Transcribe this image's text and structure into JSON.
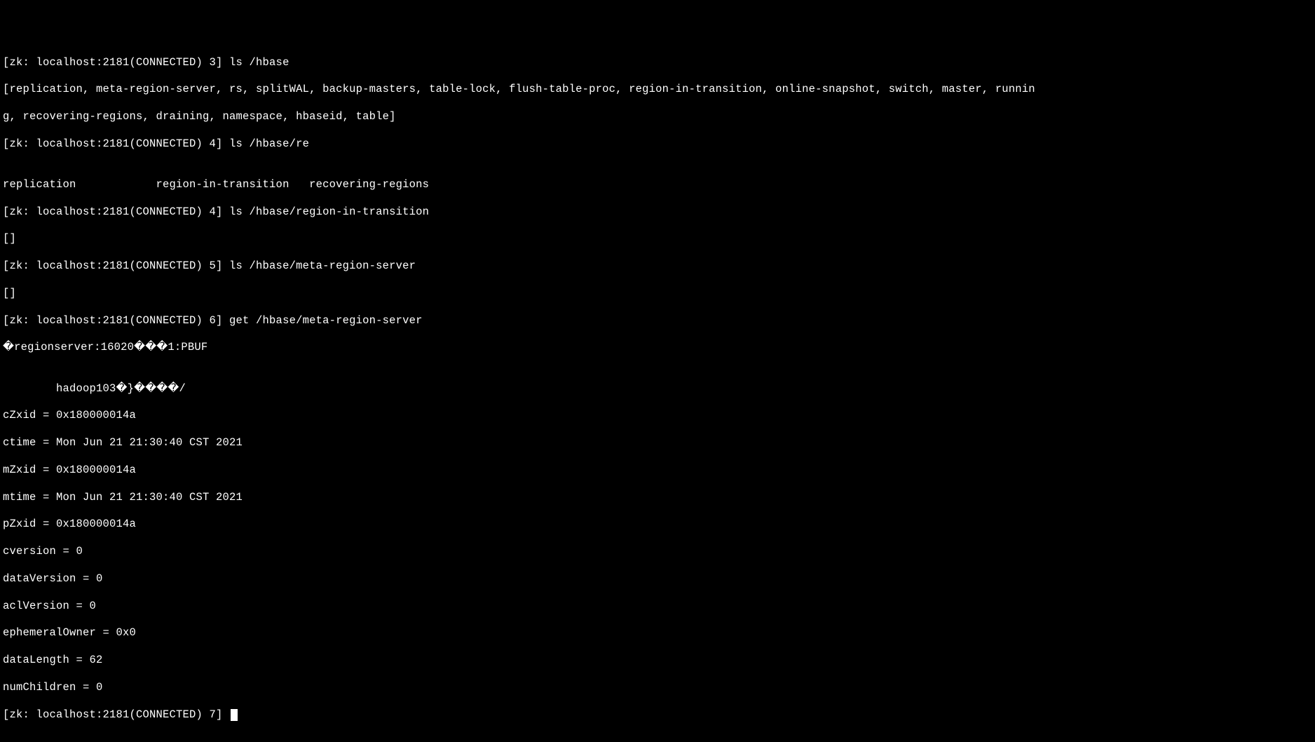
{
  "lines": {
    "l1": "[zk: localhost:2181(CONNECTED) 3] ls /hbase",
    "l2": "[replication, meta-region-server, rs, splitWAL, backup-masters, table-lock, flush-table-proc, region-in-transition, online-snapshot, switch, master, runnin",
    "l3": "g, recovering-regions, draining, namespace, hbaseid, table]",
    "l4": "[zk: localhost:2181(CONNECTED) 4] ls /hbase/re",
    "l5": "",
    "l6": "replication            region-in-transition   recovering-regions",
    "l7": "[zk: localhost:2181(CONNECTED) 4] ls /hbase/region-in-transition",
    "l8": "[]",
    "l9": "[zk: localhost:2181(CONNECTED) 5] ls /hbase/meta-region-server",
    "l10": "[]",
    "l11": "[zk: localhost:2181(CONNECTED) 6] get /hbase/meta-region-server",
    "l12": "�regionserver:16020���1:PBUF",
    "l13": "",
    "l14": "        hadoop103�}����/",
    "l15": "cZxid = 0x180000014a",
    "l16": "ctime = Mon Jun 21 21:30:40 CST 2021",
    "l17": "mZxid = 0x180000014a",
    "l18": "mtime = Mon Jun 21 21:30:40 CST 2021",
    "l19": "pZxid = 0x180000014a",
    "l20": "cversion = 0",
    "l21": "dataVersion = 0",
    "l22": "aclVersion = 0",
    "l23": "ephemeralOwner = 0x0",
    "l24": "dataLength = 62",
    "l25": "numChildren = 0",
    "l26": "[zk: localhost:2181(CONNECTED) 7] "
  }
}
